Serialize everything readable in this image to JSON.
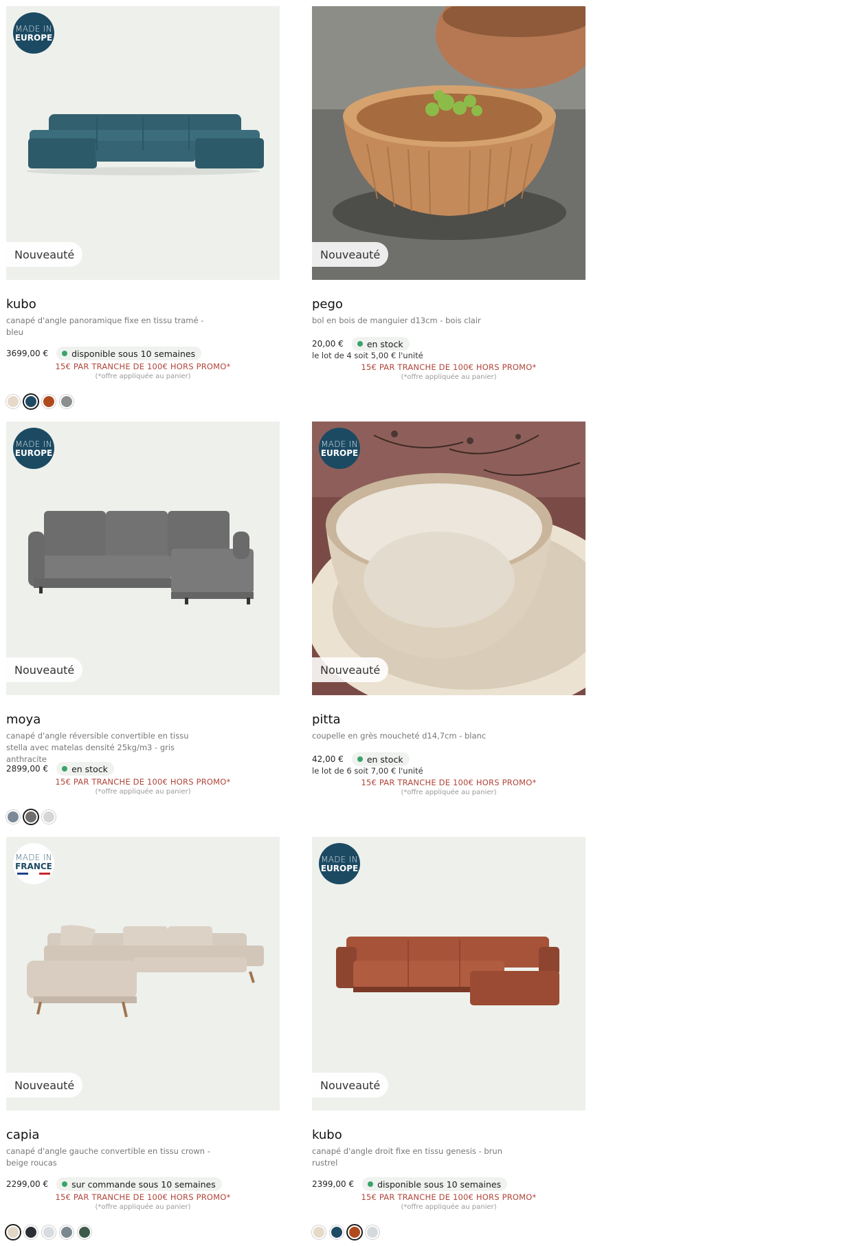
{
  "products": [
    {
      "name": "kubo",
      "description": "canapé d'angle panoramique fixe en tissu tramé - bleu",
      "origin_l1": "MADE IN",
      "origin_l2": "EUROPE",
      "tag": "Nouveauté",
      "price": "3699,00 €",
      "stock": "disponible sous 10 semaines",
      "promo": "15€ PAR TRANCHE DE 100€ HORS PROMO*",
      "promo_note": "(*offre appliquée au panier)",
      "swatches": [
        "#e6d9c8",
        "#1f4a63",
        "#b04a1e",
        "#8b8f90"
      ],
      "selected_swatch": 1
    },
    {
      "name": "pego",
      "description": "bol en bois de manguier d13cm - bois clair",
      "tag": "Nouveauté",
      "price": "20,00 €",
      "stock": "en stock",
      "lot": "le lot de 4 soit 5,00 € l'unité",
      "promo": "15€ PAR TRANCHE DE 100€ HORS PROMO*",
      "promo_note": "(*offre appliquée au panier)"
    },
    {
      "name": "moya",
      "description": "canapé d'angle réversible convertible en tissu stella avec matelas densité 25kg/m3 - gris anthracite",
      "origin_l1": "MADE IN",
      "origin_l2": "EUROPE",
      "tag": "Nouveauté",
      "price": "2899,00 €",
      "stock": "en stock",
      "promo": "15€ PAR TRANCHE DE 100€ HORS PROMO*",
      "promo_note": "(*offre appliquée au panier)",
      "swatches": [
        "#7b8a96",
        "#6f6f6f",
        "#d6d6d6"
      ],
      "selected_swatch": 1
    },
    {
      "name": "pitta",
      "description": "coupelle en grès moucheté d14,7cm - blanc",
      "origin_l1": "MADE IN",
      "origin_l2": "EUROPE",
      "tag": "Nouveauté",
      "price": "42,00 €",
      "stock": "en stock",
      "lot": "le lot de 6 soit 7,00 € l'unité",
      "promo": "15€ PAR TRANCHE DE 100€ HORS PROMO*",
      "promo_note": "(*offre appliquée au panier)"
    },
    {
      "name": "capia",
      "description": "canapé d'angle gauche convertible en tissu crown - beige roucas",
      "origin_l1": "MADE IN",
      "origin_l2": "FRANCE",
      "tag": "Nouveauté",
      "price": "2299,00 €",
      "stock": "sur commande sous 10 semaines",
      "promo": "15€ PAR TRANCHE DE 100€ HORS PROMO*",
      "promo_note": "(*offre appliquée au panier)",
      "swatches": [
        "#e3d7c5",
        "#2c2e36",
        "#d8dcdf",
        "#7b8890",
        "#3d5a4c"
      ],
      "selected_swatch": 0
    },
    {
      "name": "kubo",
      "description": "canapé d'angle droit fixe en tissu genesis - brun rustrel",
      "origin_l1": "MADE IN",
      "origin_l2": "EUROPE",
      "tag": "Nouveauté",
      "price": "2399,00 €",
      "stock": "disponible sous 10 semaines",
      "promo": "15€ PAR TRANCHE DE 100€ HORS PROMO*",
      "promo_note": "(*offre appliquée au panier)",
      "swatches": [
        "#e6d9c8",
        "#1f4a63",
        "#b04a1e",
        "#d6d9dc"
      ],
      "selected_swatch": 2
    }
  ]
}
